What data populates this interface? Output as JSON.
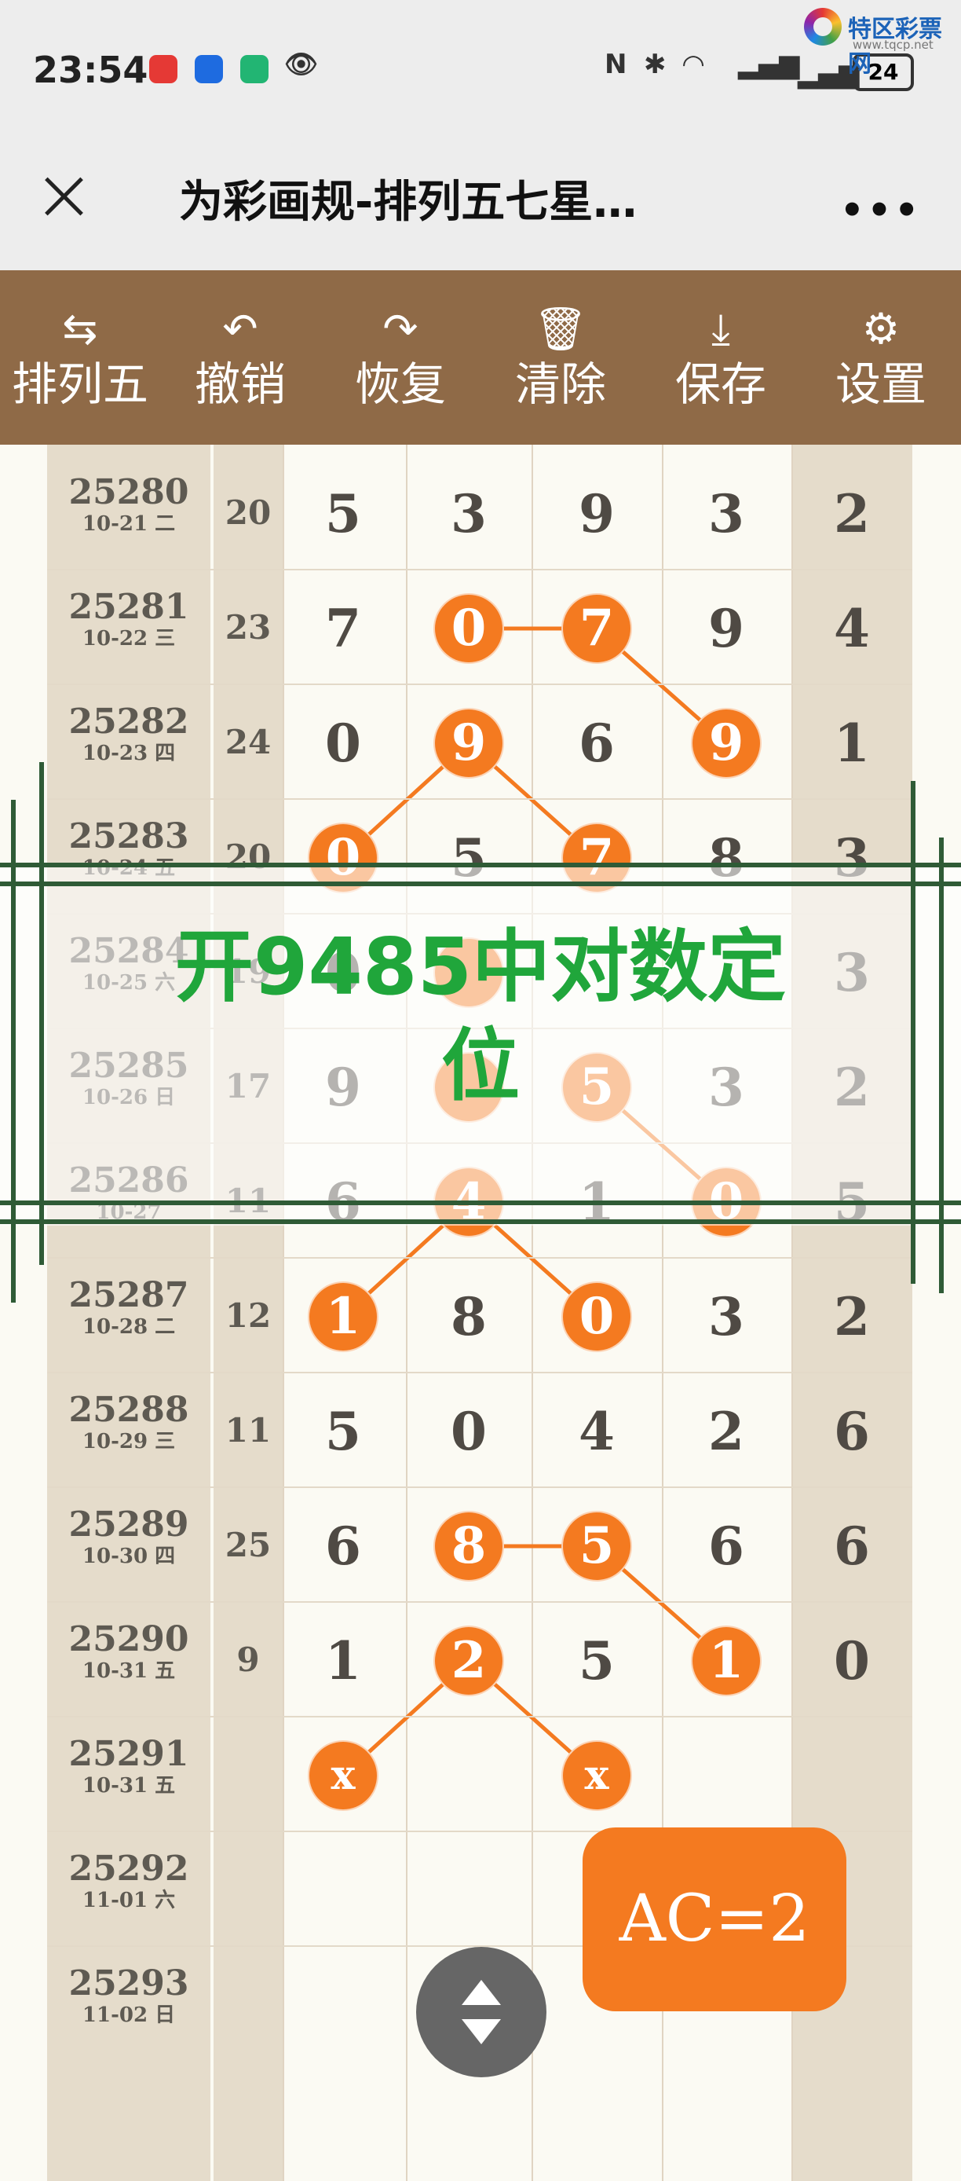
{
  "status": {
    "time": "23:54",
    "battery": "24"
  },
  "watermark": {
    "name": "特区彩票网",
    "url": "www.tqcp.net"
  },
  "header": {
    "title": "为彩画规-排列五七星…",
    "more": "•••"
  },
  "toolbar": [
    {
      "label": "排列五",
      "icon": "swap-icon",
      "glyph": "⇆"
    },
    {
      "label": "撤销",
      "icon": "undo-icon",
      "glyph": "↶"
    },
    {
      "label": "恢复",
      "icon": "redo-icon",
      "glyph": "↷"
    },
    {
      "label": "清除",
      "icon": "trash-icon",
      "glyph": "🗑"
    },
    {
      "label": "保存",
      "icon": "download-icon",
      "glyph": "⤓"
    },
    {
      "label": "设置",
      "icon": "gear-icon",
      "glyph": "⚙"
    }
  ],
  "rows": [
    {
      "issue": "25280",
      "date": "10-21 二",
      "sum": "20",
      "digits": [
        "5",
        "3",
        "9",
        "3",
        "2"
      ],
      "hl": []
    },
    {
      "issue": "25281",
      "date": "10-22 三",
      "sum": "23",
      "digits": [
        "7",
        "0",
        "7",
        "9",
        "4"
      ],
      "hl": [
        1,
        2
      ]
    },
    {
      "issue": "25282",
      "date": "10-23 四",
      "sum": "24",
      "digits": [
        "0",
        "9",
        "6",
        "9",
        "1"
      ],
      "hl": [
        1,
        3
      ]
    },
    {
      "issue": "25283",
      "date": "10-24 五",
      "sum": "20",
      "digits": [
        "0",
        "5",
        "7",
        "8",
        "3"
      ],
      "hl": [
        0,
        2
      ]
    },
    {
      "issue": "25284",
      "date": "10-25 六",
      "sum": "19",
      "digits": [
        "0",
        "",
        "",
        "",
        "3"
      ],
      "hl": [
        1
      ]
    },
    {
      "issue": "25285",
      "date": "10-26 日",
      "sum": "17",
      "digits": [
        "9",
        "",
        "5",
        "3",
        "2"
      ],
      "hl": [
        1,
        2
      ]
    },
    {
      "issue": "25286",
      "date": "10-27",
      "sum": "11",
      "digits": [
        "6",
        "4",
        "1",
        "0",
        "5"
      ],
      "hl": [
        1,
        3
      ]
    },
    {
      "issue": "25287",
      "date": "10-28 二",
      "sum": "12",
      "digits": [
        "1",
        "8",
        "0",
        "3",
        "2"
      ],
      "hl": [
        0,
        2
      ]
    },
    {
      "issue": "25288",
      "date": "10-29 三",
      "sum": "11",
      "digits": [
        "5",
        "0",
        "4",
        "2",
        "6"
      ],
      "hl": []
    },
    {
      "issue": "25289",
      "date": "10-30 四",
      "sum": "25",
      "digits": [
        "6",
        "8",
        "5",
        "6",
        "6"
      ],
      "hl": [
        1,
        2
      ]
    },
    {
      "issue": "25290",
      "date": "10-31 五",
      "sum": "9",
      "digits": [
        "1",
        "2",
        "5",
        "1",
        "0"
      ],
      "hl": [
        1,
        3
      ]
    },
    {
      "issue": "25291",
      "date": "10-31 五",
      "sum": "",
      "digits": [
        "x",
        "",
        "x",
        "",
        ""
      ],
      "hl": [
        0,
        2
      ]
    },
    {
      "issue": "25292",
      "date": "11-01 六",
      "sum": "",
      "digits": [
        "",
        "",
        "",
        "",
        ""
      ],
      "hl": []
    },
    {
      "issue": "25293",
      "date": "11-02 日",
      "sum": "",
      "digits": [
        "",
        "",
        "",
        "",
        ""
      ],
      "hl": []
    }
  ],
  "banner": {
    "line1": "开9485中对数定",
    "line2": "位"
  },
  "ac_badge": "AC=2"
}
